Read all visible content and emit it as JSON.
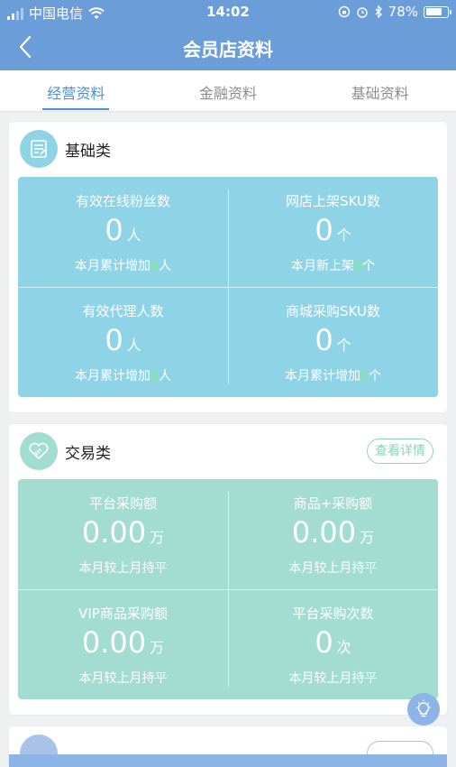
{
  "status_bar": {
    "carrier": "中国电信",
    "time": "14:02",
    "battery": "78%",
    "battery_level": 0.78
  },
  "nav": {
    "title": "会员店资料"
  },
  "tabs": [
    {
      "label": "经营资料"
    },
    {
      "label": "金融资料"
    },
    {
      "label": "基础资料"
    }
  ],
  "basic": {
    "title": "基础类",
    "cells": [
      {
        "label": "有效在线粉丝数",
        "value": "0",
        "unit": "人",
        "sub_prefix": "本月累计增加",
        "sub_value": "0",
        "sub_suffix": "人"
      },
      {
        "label": "网店上架SKU数",
        "value": "0",
        "unit": "个",
        "sub_prefix": "本月新上架",
        "sub_value": "0",
        "sub_suffix": "个"
      },
      {
        "label": "有效代理人数",
        "value": "0",
        "unit": "人",
        "sub_prefix": "本月累计增加",
        "sub_value": "0",
        "sub_suffix": "人"
      },
      {
        "label": "商城采购SKU数",
        "value": "0",
        "unit": "个",
        "sub_prefix": "本月累计增加",
        "sub_value": "0",
        "sub_suffix": "个"
      }
    ]
  },
  "trade": {
    "title": "交易类",
    "detail_label": "查看详情",
    "cells": [
      {
        "label": "平台采购额",
        "value": "0.00",
        "unit": "万",
        "sub": "本月较上月持平"
      },
      {
        "label": "商品+采购额",
        "value": "0.00",
        "unit": "万",
        "sub": "本月较上月持平"
      },
      {
        "label": "VIP商品采购额",
        "value": "0.00",
        "unit": "万",
        "sub": "本月较上月持平"
      },
      {
        "label": "平台采购次数",
        "value": "0",
        "unit": "次",
        "sub": "本月较上月持平"
      }
    ]
  },
  "colors": {
    "header": "#6b9ed8",
    "basic_grid": "#8ed3e6",
    "trade_grid": "#a3ddd1",
    "accent": "#4a90d9",
    "highlight": "#7cf07c"
  },
  "icons": [
    "back-icon",
    "wifi-icon",
    "signal-icon",
    "document-icon",
    "handshake-icon",
    "lightbulb-icon",
    "alarm-icon",
    "bluetooth-icon",
    "rotation-lock-icon"
  ]
}
